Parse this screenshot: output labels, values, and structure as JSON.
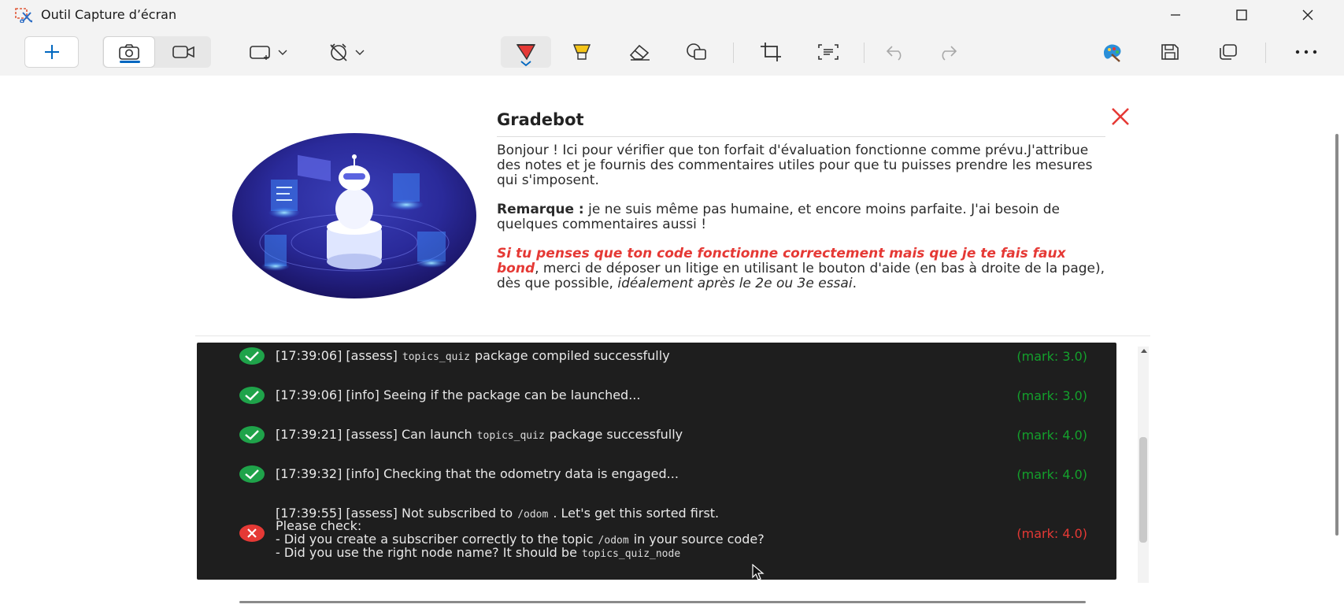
{
  "window": {
    "title": "Outil Capture d’écran",
    "minimize_icon": "minimize-icon",
    "maximize_icon": "maximize-icon",
    "close_icon": "close-icon"
  },
  "toolbar": {
    "new_icon": "plus-icon",
    "photo_icon": "camera-icon",
    "video_icon": "video-icon",
    "shape_icon": "rectangle-snip-icon",
    "timer_icon": "no-timer-icon",
    "tools": [
      "ballpoint-pen-icon",
      "highlighter-icon",
      "eraser-icon",
      "shapes-icon",
      "crop-icon",
      "text-actions-icon",
      "undo-icon",
      "redo-icon",
      "edit-in-paint-icon",
      "save-icon",
      "copy-icon",
      "more-icon"
    ],
    "accent_color": "#0067c0",
    "pen_color": "#e53935",
    "highlighter_color": "#f5c518"
  },
  "gradebot": {
    "title": "Gradebot",
    "para1": "Bonjour ! Ici pour vérifier que ton forfait d'évaluation fonctionne comme prévu.J'attribue des notes et je fournis des commentaires utiles pour que tu puisses prendre les mesures qui s'imposent.",
    "remark_label": "Remarque :",
    "remark_text": " je ne suis même pas humaine, et encore moins parfaite. J'ai besoin de quelques commentaires aussi !",
    "warn_red": "Si tu penses que ton code fonctionne correctement mais que je te fais faux bond",
    "warn_text": ", merci de déposer un litige en utilisant le bouton d'aide (en bas à droite de la page), dès que possible, ",
    "warn_italic": "idéalement après le 2e ou 3e essai",
    "warn_end": "."
  },
  "log": [
    {
      "status": "success",
      "pre": "[17:39:06] [assess]",
      "code": "topics_quiz",
      "post": "package compiled successfully",
      "mark": "(mark: 3.0)"
    },
    {
      "status": "success",
      "pre": "[17:39:06] [info] Seeing if the package can be launched...",
      "code": "",
      "post": "",
      "mark": "(mark: 3.0)"
    },
    {
      "status": "success",
      "pre": "[17:39:21] [assess] Can launch",
      "code": "topics_quiz",
      "post": "package successfully",
      "mark": "(mark: 4.0)"
    },
    {
      "status": "success",
      "pre": "[17:39:32] [info] Checking that the odometry data is engaged...",
      "code": "",
      "post": "",
      "mark": "(mark: 4.0)"
    }
  ],
  "log_error": {
    "line1_pre": "[17:39:55] [assess] Not subscribed to",
    "line1_code": "/odom",
    "line1_post": ". Let's get this sorted first.",
    "line2": "Please check:",
    "line3_pre": "- Did you create a subscriber correctly to the topic",
    "line3_code": "/odom",
    "line3_post": "in your source code?",
    "line4_pre": "- Did you use the right node name? It should be",
    "line4_code": "topics_quiz_node",
    "mark": "(mark: 4.0)"
  }
}
